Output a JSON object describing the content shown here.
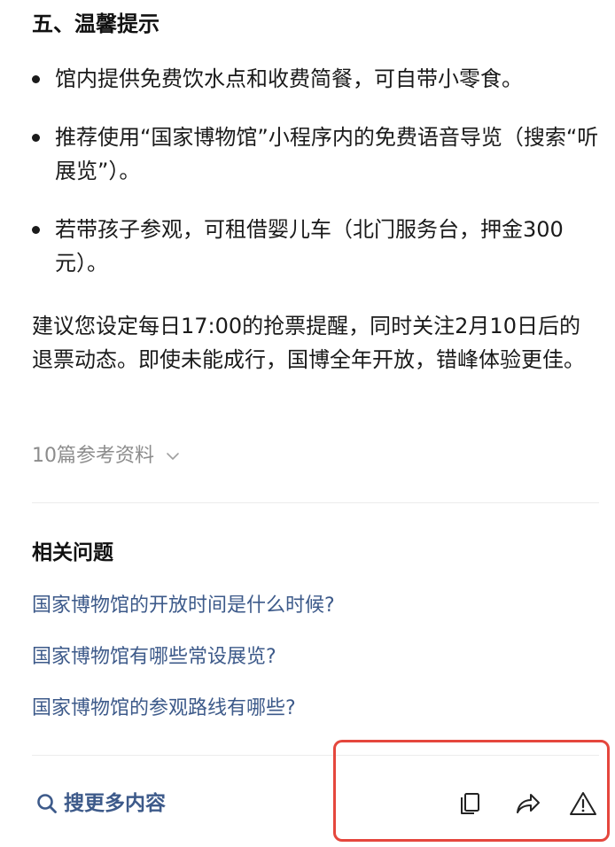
{
  "section": {
    "title": "五、温馨提示"
  },
  "tips": [
    "馆内提供免费饮水点和收费简餐，可自带小零食。",
    "推荐使用“国家博物馆”小程序内的免费语音导览（搜索“听展览”）。",
    "若带孩子参观，可租借婴儿车（北门服务台，押金300元）。"
  ],
  "advice": "建议您设定每日17:00的抢票提醒，同时关注2月10日后的退票动态。即使未能成行，国博全年开放，错峰体验更佳。",
  "references": {
    "label": "10篇参考资料",
    "icon": "chevron-down-icon"
  },
  "related": {
    "title": "相关问题",
    "items": [
      "国家博物馆的开放时间是什么时候?",
      "国家博物馆有哪些常设展览?",
      "国家博物馆的参观路线有哪些?"
    ]
  },
  "footer": {
    "search_more_label": "搜更多内容",
    "actions": [
      "copy-icon",
      "share-icon",
      "report-icon"
    ]
  },
  "colors": {
    "link": "#3d5a8a",
    "muted": "#8c8c8c",
    "highlight": "#e5473d"
  }
}
